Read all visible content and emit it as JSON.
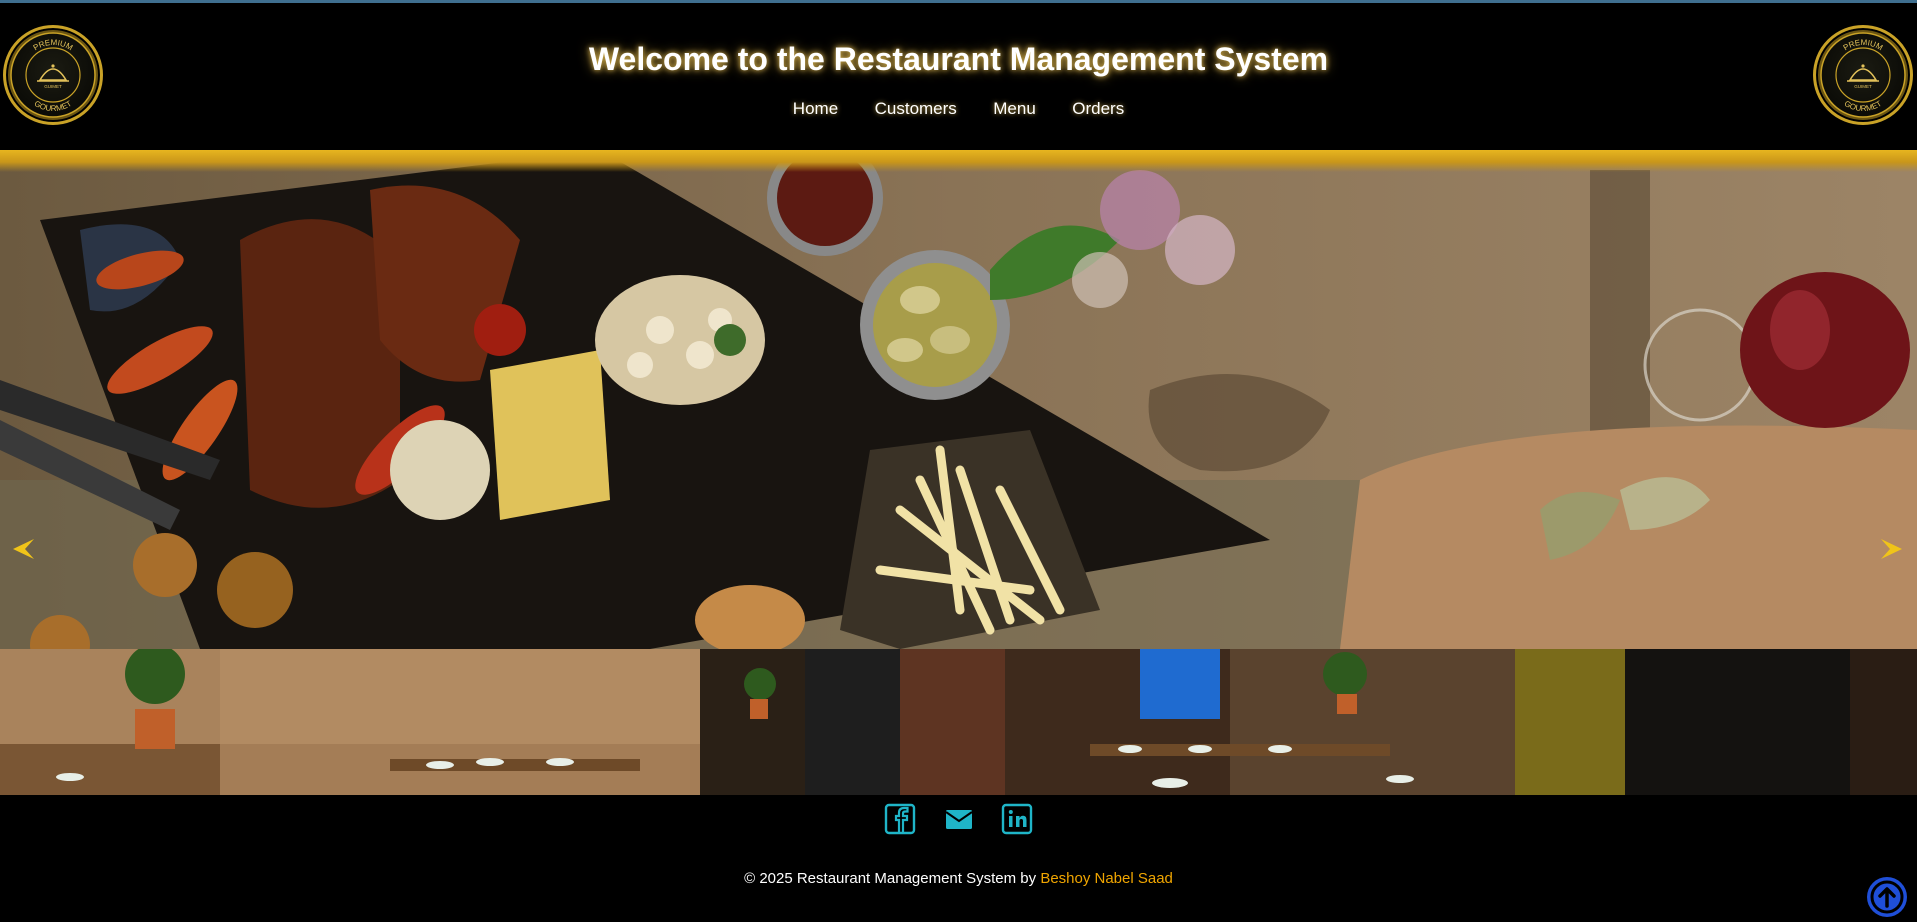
{
  "header": {
    "title": "Welcome to the Restaurant Management System",
    "logo": {
      "top_text": "PREMIUM",
      "bottom_text": "GOURMET",
      "center_text": "GUIMET"
    }
  },
  "nav": {
    "items": [
      {
        "label": "Home"
      },
      {
        "label": "Customers"
      },
      {
        "label": "Menu"
      },
      {
        "label": "Orders"
      }
    ]
  },
  "carousel": {
    "prev_icon": "arrow-left-icon",
    "next_icon": "arrow-right-icon",
    "accent_color": "#f0c419"
  },
  "social": {
    "icons": [
      "facebook-icon",
      "email-icon",
      "linkedin-icon"
    ],
    "color": "#1fb5c8"
  },
  "footer": {
    "copyright": "© 2025 Restaurant Management System by ",
    "author": "Beshoy Nabel Saad",
    "author_color": "#f0a500"
  },
  "scroll_top": {
    "icon": "arrow-up-circle-icon",
    "color": "#1f4fd8"
  }
}
